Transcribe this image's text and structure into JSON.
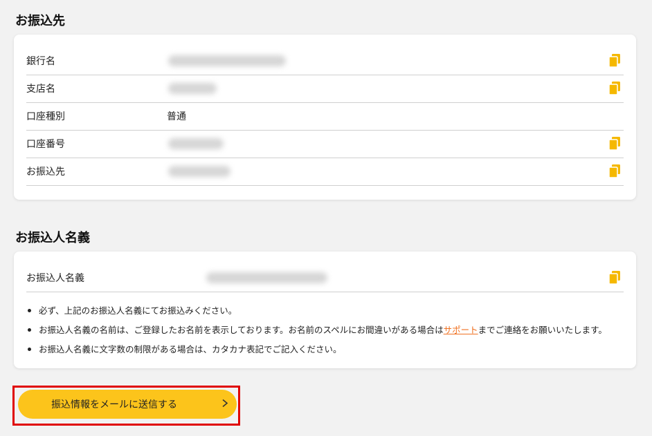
{
  "transfer_destination": {
    "title": "お振込先",
    "rows": [
      {
        "label": "銀行名",
        "value": "",
        "copyable": true
      },
      {
        "label": "支店名",
        "value": "",
        "copyable": true
      },
      {
        "label": "口座種別",
        "value": "普通",
        "copyable": false
      },
      {
        "label": "口座番号",
        "value": "",
        "copyable": true
      },
      {
        "label": "お振込先",
        "value": "",
        "copyable": true
      }
    ]
  },
  "transfer_name": {
    "title": "お振込人名義",
    "row": {
      "label": "お振込人名義",
      "value": "",
      "copyable": true
    },
    "notes": {
      "note1": "必ず、上記のお振込人名義にてお振込みください。",
      "note2_prefix": "お振込人名義の名前は、ご登録したお名前を表示しております。お名前のスペルにお間違いがある場合は",
      "note2_link": "サポート",
      "note2_suffix": "までご連絡をお願いいたします。",
      "note3": "お振込人名義に文字数の制限がある場合は、カタカナ表記でご記入ください。"
    }
  },
  "send_button": {
    "label": "振込情報をメールに送信する",
    "icon": "chevron-right-icon"
  },
  "colors": {
    "accent": "#fcc41b",
    "link": "#f07020",
    "highlight_border": "#e00000",
    "icon": "#f5b800"
  }
}
